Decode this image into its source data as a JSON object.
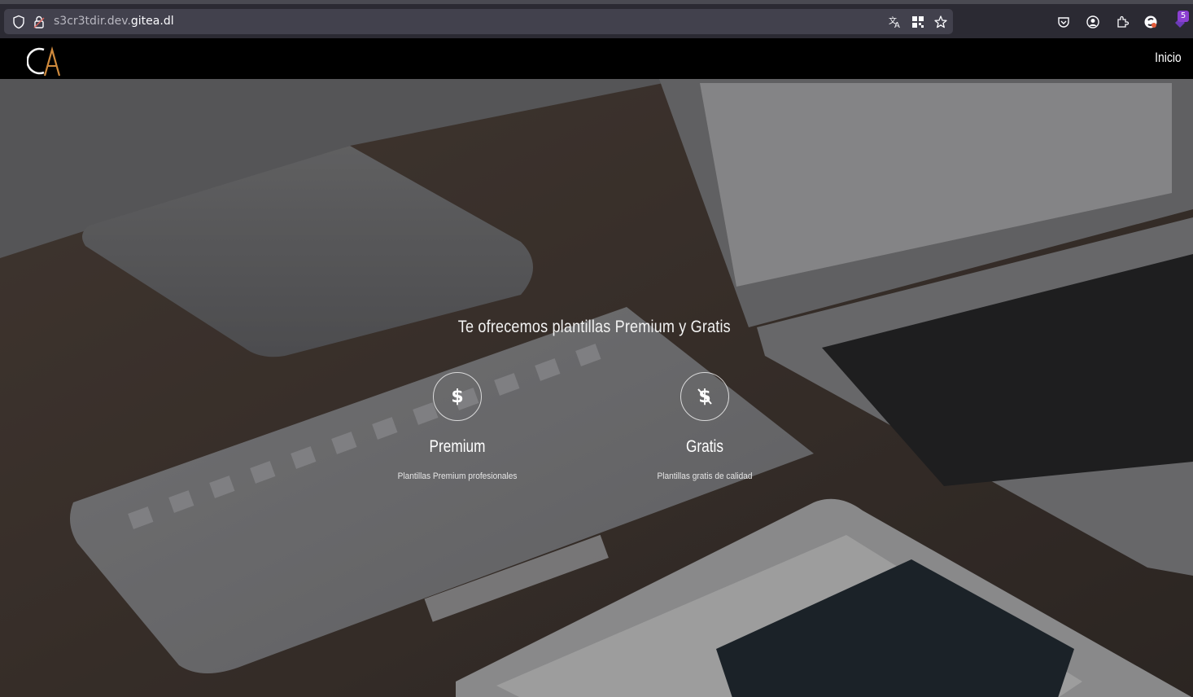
{
  "browser": {
    "url_subdomain": "s3cr3tdir.dev.",
    "url_domain": "gitea.dl",
    "extension_badge": "5",
    "icons": [
      "shield-icon",
      "lock-icon",
      "translate-icon",
      "qr-code-icon",
      "bookmark-star-icon",
      "pocket-icon",
      "account-icon",
      "extensions-icon",
      "sync-icon",
      "extension-icon"
    ]
  },
  "site": {
    "logo_text": "CA",
    "nav": {
      "home_label": "Inicio"
    }
  },
  "hero": {
    "title": "Te ofrecemos plantillas Premium y Gratis",
    "features": [
      {
        "icon": "dollar-icon",
        "title": "Premium",
        "description": "Plantillas Premium profesionales"
      },
      {
        "icon": "dollar-off-icon",
        "title": "Gratis",
        "description": "Plantillas gratis de calidad"
      }
    ]
  },
  "colors": {
    "nav_bg": "#000000",
    "logo_accent": "#d08a3c",
    "browser_bg": "#2b2a33",
    "urlbar_bg": "#42414d"
  }
}
